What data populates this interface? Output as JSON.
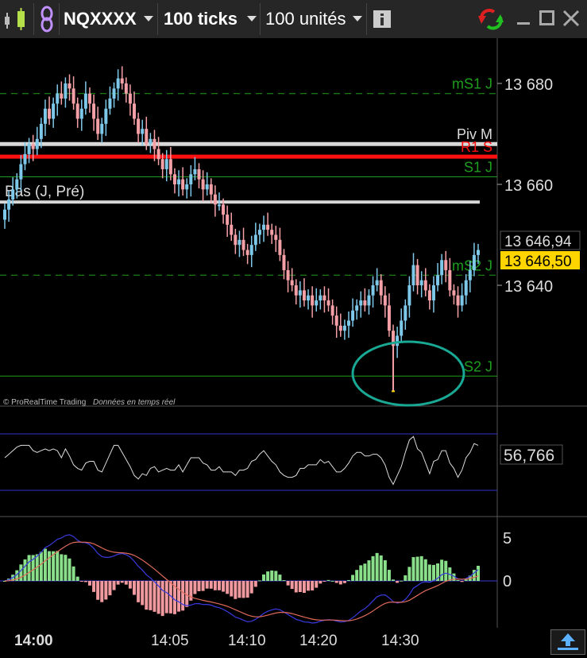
{
  "toolbar": {
    "instrument": "NQXXXX",
    "interval": "100 ticks",
    "units": "100 unités"
  },
  "colors": {
    "candle_up": "#7ec8ea",
    "candle_down": "#f4a0a6",
    "support": "#1e9e1e",
    "resistance": "#ff1010",
    "pivot": "#d8d8d8",
    "price_tag": "#ffd500",
    "ellipse": "#18a894",
    "rsi_band": "#3535c8",
    "macd_fast": "#3a3ae0",
    "macd_slow": "#e06a5a",
    "hist_pos": "#8ae08a",
    "hist_neg": "#f09aa0"
  },
  "main_chart": {
    "copyright": "© ProRealTime Trading",
    "realtime": "Données en temps réel",
    "y_ticks": [
      "13 680",
      "13 660",
      "13 640"
    ],
    "y_values": [
      13680,
      13660,
      13640
    ],
    "last_price": "13 646,94",
    "current_price": "13 646,50",
    "levels": [
      {
        "label": "mS1 J",
        "value": 13678,
        "style": "dashed",
        "color": "support"
      },
      {
        "label": "Piv M",
        "value": 13668,
        "style": "thick",
        "color": "pivot"
      },
      {
        "label": "R1 S",
        "value": 13665.5,
        "style": "thick",
        "color": "resistance"
      },
      {
        "label": "S1 J",
        "value": 13661.5,
        "style": "solid",
        "color": "support"
      },
      {
        "label": "Bas (J, Pré)",
        "value": 13656.5,
        "style": "thick",
        "color": "pivot"
      },
      {
        "label": "mS2 J",
        "value": 13642,
        "style": "dashed",
        "color": "support"
      },
      {
        "label": "S2 J",
        "value": 13622,
        "style": "solid",
        "color": "support"
      }
    ]
  },
  "rsi": {
    "value_label": "56,766"
  },
  "macd": {
    "y_ticks": [
      "5",
      "0"
    ]
  },
  "x_axis": {
    "labels": [
      "14:00",
      "14:05",
      "14:10",
      "14:20",
      "14:30"
    ]
  }
}
